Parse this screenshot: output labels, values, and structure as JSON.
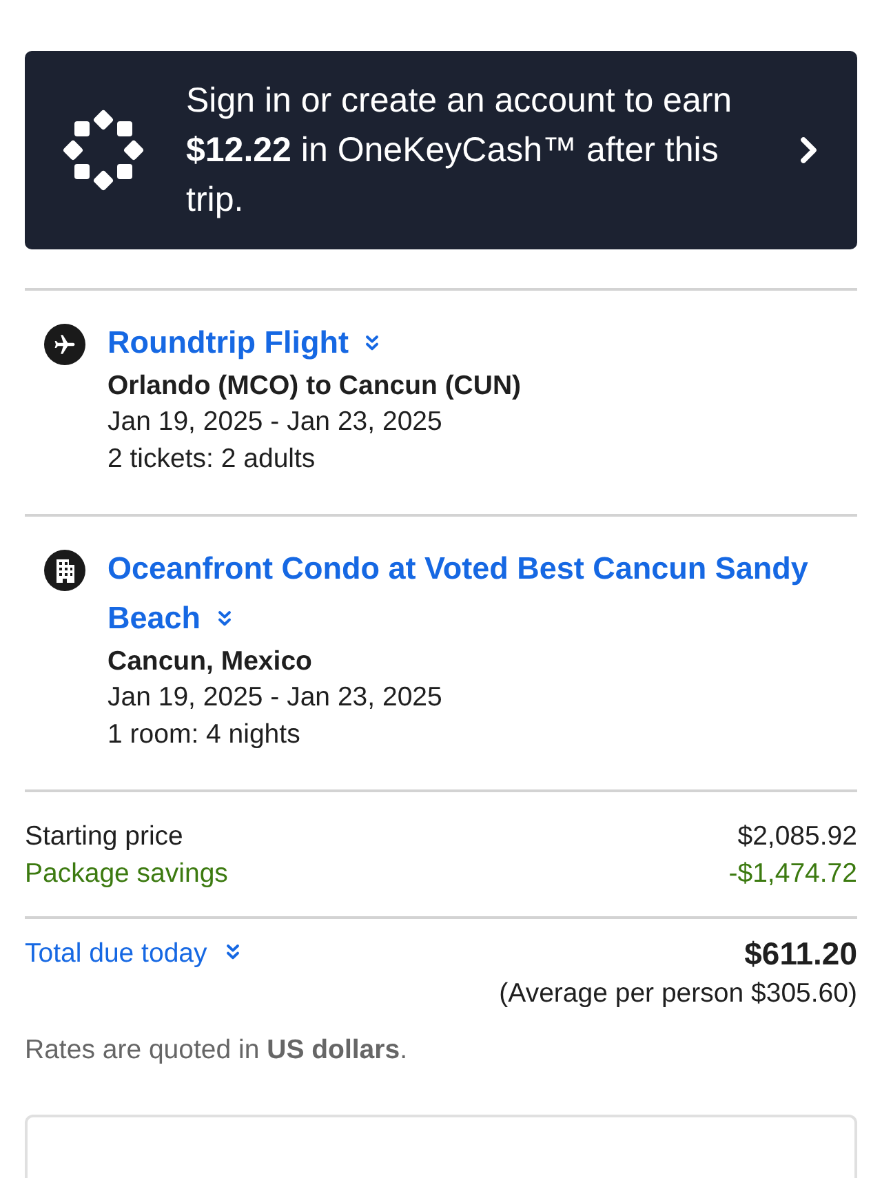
{
  "banner": {
    "message": "Sign in or create an account to earn **$12.22** in OneKeyCash™ after this trip."
  },
  "items": [
    {
      "kind": "flight",
      "title": "Roundtrip Flight",
      "subtitle": "Orlando (MCO) to Cancun (CUN)",
      "dates": "Jan 19, 2025 - Jan 23, 2025",
      "details": "2 tickets: 2 adults"
    },
    {
      "kind": "hotel",
      "title": "Oceanfront Condo at Voted Best Cancun Sandy Beach",
      "subtitle": "Cancun, Mexico",
      "dates": "Jan 19, 2025 - Jan 23, 2025",
      "details": "1 room: 4 nights"
    }
  ],
  "price_summary": {
    "lines": [
      {
        "kind": "regular",
        "label": "Starting price",
        "amount": "$2,085.92"
      },
      {
        "kind": "savings",
        "label": "Package savings",
        "amount": "-$1,474.72"
      }
    ],
    "total": {
      "label": "Total due today",
      "amount": "$611.20",
      "note": "(Average per person $305.60)"
    },
    "rates_note": "Rates are quoted in **US dollars**."
  }
}
